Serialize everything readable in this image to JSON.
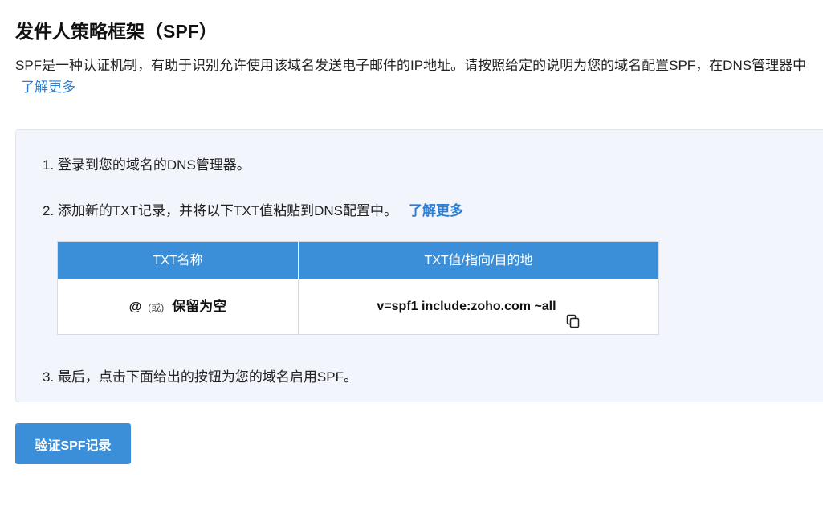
{
  "header": {
    "title": "发件人策略框架（SPF）",
    "description": "SPF是一种认证机制，有助于识别允许使用该域名发送电子邮件的IP地址。请按照给定的说明为您的域名配置SPF，在DNS管理器中",
    "learn_more": "了解更多"
  },
  "steps": {
    "step1": "1. 登录到您的域名的DNS管理器。",
    "step2": "2. 添加新的TXT记录，并将以下TXT值粘贴到DNS配置中。",
    "step2_learn_more": "了解更多",
    "step3": "3. 最后，点击下面给出的按钮为您的域名启用SPF。"
  },
  "table": {
    "headers": [
      "TXT名称",
      "TXT值/指向/目的地"
    ],
    "name_at": "@",
    "name_or": "(或)",
    "name_blank": "保留为空",
    "value": "v=spf1 include:zoho.com ~all"
  },
  "verify_button": "验证SPF记录",
  "colors": {
    "accent": "#3b8fd9",
    "link": "#2a7fd4",
    "panel_bg": "#f2f6fc"
  },
  "icons": {
    "copy": "copy-icon"
  }
}
